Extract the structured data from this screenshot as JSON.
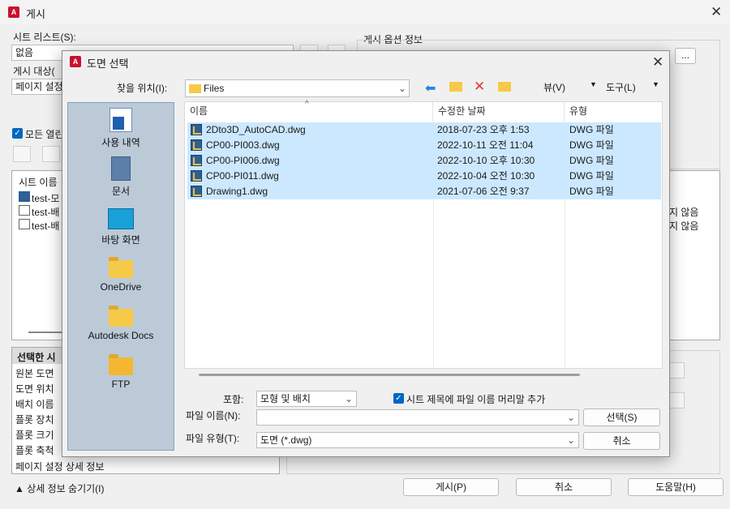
{
  "main": {
    "title": "게시",
    "sheet_list_label": "시트 리스트(S):",
    "sheet_list_value": "없음",
    "publish_to_label": "게시 대상(",
    "page_setup_value": "페이지 설정",
    "options_title": "게시 옵션 정보",
    "options_btn": "...",
    "all_open_label": "모든 열린",
    "sheet_name_header": "시트 이름",
    "sheets": [
      "test-모",
      "test-배",
      "test-배"
    ],
    "right_status": [
      "지 않음",
      "지 않음"
    ],
    "details_header": "선택한 시",
    "details_items": [
      "원본 도면",
      "도면 위치",
      "배치 이름",
      "플롯 장치",
      "플롯 크기",
      "플롯 축척",
      "페이지 설정 상세 정보"
    ],
    "hide_details": "▲ 상세 정보 숨기기(I)",
    "publish_btn": "게시(P)",
    "cancel_btn": "취소",
    "help_btn": "도움말(H)"
  },
  "dialog": {
    "title": "도면 선택",
    "look_in_label": "찾을 위치(I):",
    "look_in_value": "Files",
    "view_menu": "뷰(V)",
    "tools_menu": "도구(L)",
    "places": [
      {
        "label": "사용 내역",
        "icon": "history-icon"
      },
      {
        "label": "문서",
        "icon": "documents-icon"
      },
      {
        "label": "바탕 화면",
        "icon": "desktop-icon"
      },
      {
        "label": "OneDrive",
        "icon": "onedrive-folder-icon"
      },
      {
        "label": "Autodesk Docs",
        "icon": "autodesk-docs-folder-icon"
      },
      {
        "label": "FTP",
        "icon": "ftp-folder-icon"
      }
    ],
    "columns": {
      "name": "이름",
      "date": "수정한 날짜",
      "type": "유형"
    },
    "files": [
      {
        "name": "2Dto3D_AutoCAD.dwg",
        "date": "2018-07-23 오후 1:53",
        "type": "DWG 파일"
      },
      {
        "name": "CP00-PI003.dwg",
        "date": "2022-10-11 오전 11:04",
        "type": "DWG 파일"
      },
      {
        "name": "CP00-PI006.dwg",
        "date": "2022-10-10 오후 10:30",
        "type": "DWG 파일"
      },
      {
        "name": "CP00-PI011.dwg",
        "date": "2022-10-04 오전 10:30",
        "type": "DWG 파일"
      },
      {
        "name": "Drawing1.dwg",
        "date": "2021-07-06 오전 9:37",
        "type": "DWG 파일"
      }
    ],
    "include_label": "포함:",
    "include_value": "모형 및 배치",
    "prefix_checkbox": "시트 제목에 파일 이름 머리말 추가",
    "filename_label": "파일 이름(N):",
    "filename_value": "",
    "filetype_label": "파일 유형(T):",
    "filetype_value": "도면 (*.dwg)",
    "select_btn": "선택(S)",
    "cancel_btn": "취소"
  }
}
